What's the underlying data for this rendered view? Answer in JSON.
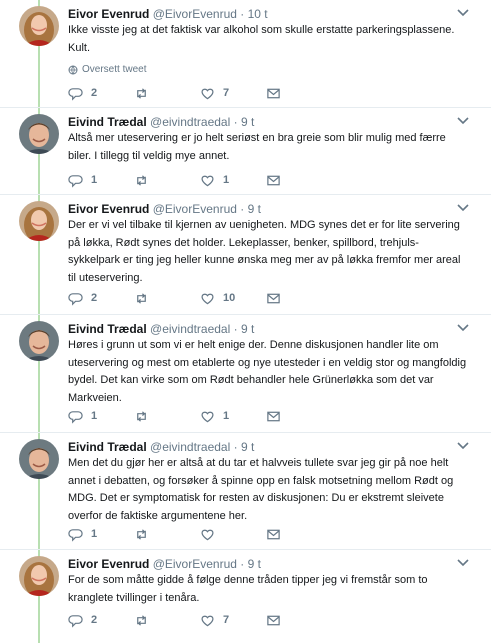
{
  "thread": {
    "tweets": [
      {
        "name": "Eivor Evenrud",
        "handle": "@EivorEvenrud",
        "separator": "·",
        "time": "10 t",
        "text": "Ikke visste jeg at det faktisk var alkohol som skulle erstatte parkeringsplassene. Kult.",
        "translate_label": "Oversett tweet",
        "replies": "2",
        "retweets": "",
        "likes": "7",
        "avatar": "woman"
      },
      {
        "name": "Eivind Trædal",
        "handle": "@eivindtraedal",
        "separator": "·",
        "time": "9 t",
        "text": "Altså mer uteservering er jo helt seriøst en bra greie som blir mulig med færre biler. I tillegg til veldig mye annet.",
        "replies": "1",
        "retweets": "",
        "likes": "1",
        "avatar": "man"
      },
      {
        "name": "Eivor Evenrud",
        "handle": "@EivorEvenrud",
        "separator": "·",
        "time": "9 t",
        "text": "Der er vi vel tilbake til kjernen av uenigheten. MDG synes det er for lite servering på løkka, Rødt synes det holder.   Lekeplasser, benker, spillbord, trehjuls-sykkelpark er ting jeg heller kunne ønska meg mer av på løkka fremfor mer areal til uteservering.",
        "replies": "2",
        "retweets": "",
        "likes": "10",
        "avatar": "woman"
      },
      {
        "name": "Eivind Trædal",
        "handle": "@eivindtraedal",
        "separator": "·",
        "time": "9 t",
        "text": "Høres i grunn ut som vi er helt enige der. Denne diskusjonen handler lite om uteservering og mest om etablerte og nye utesteder i en veldig stor og mangfoldig bydel. Det kan virke som om Rødt behandler hele Grünerløkka som det var Markveien.",
        "replies": "1",
        "retweets": "",
        "likes": "1",
        "avatar": "man"
      },
      {
        "name": "Eivind Trædal",
        "handle": "@eivindtraedal",
        "separator": "·",
        "time": "9 t",
        "text": "Men det du gjør her er altså at du tar et halvveis tullete svar jeg gir på noe helt annet i debatten, og forsøker å spinne opp en falsk motsetning mellom Rødt og MDG. Det er symptomatisk for resten av diskusjonen: Du er ekstremt sleivete overfor de faktiske argumentene her.",
        "replies": "1",
        "retweets": "",
        "likes": "",
        "avatar": "man"
      },
      {
        "name": "Eivor Evenrud",
        "handle": "@EivorEvenrud",
        "separator": "·",
        "time": "9 t",
        "text": "For de som måtte gidde å følge denne tråden tipper jeg vi fremstår som to kranglete tvillinger i tenåra.",
        "replies": "2",
        "retweets": "",
        "likes": "7",
        "avatar": "woman"
      }
    ]
  },
  "colors": {
    "thread_line": "#b8dfb1",
    "secondary_text": "#657786",
    "primary_text": "#14171a"
  },
  "icons": [
    "reply-icon",
    "retweet-icon",
    "like-icon",
    "message-icon",
    "caret-down-icon",
    "globe-icon"
  ]
}
